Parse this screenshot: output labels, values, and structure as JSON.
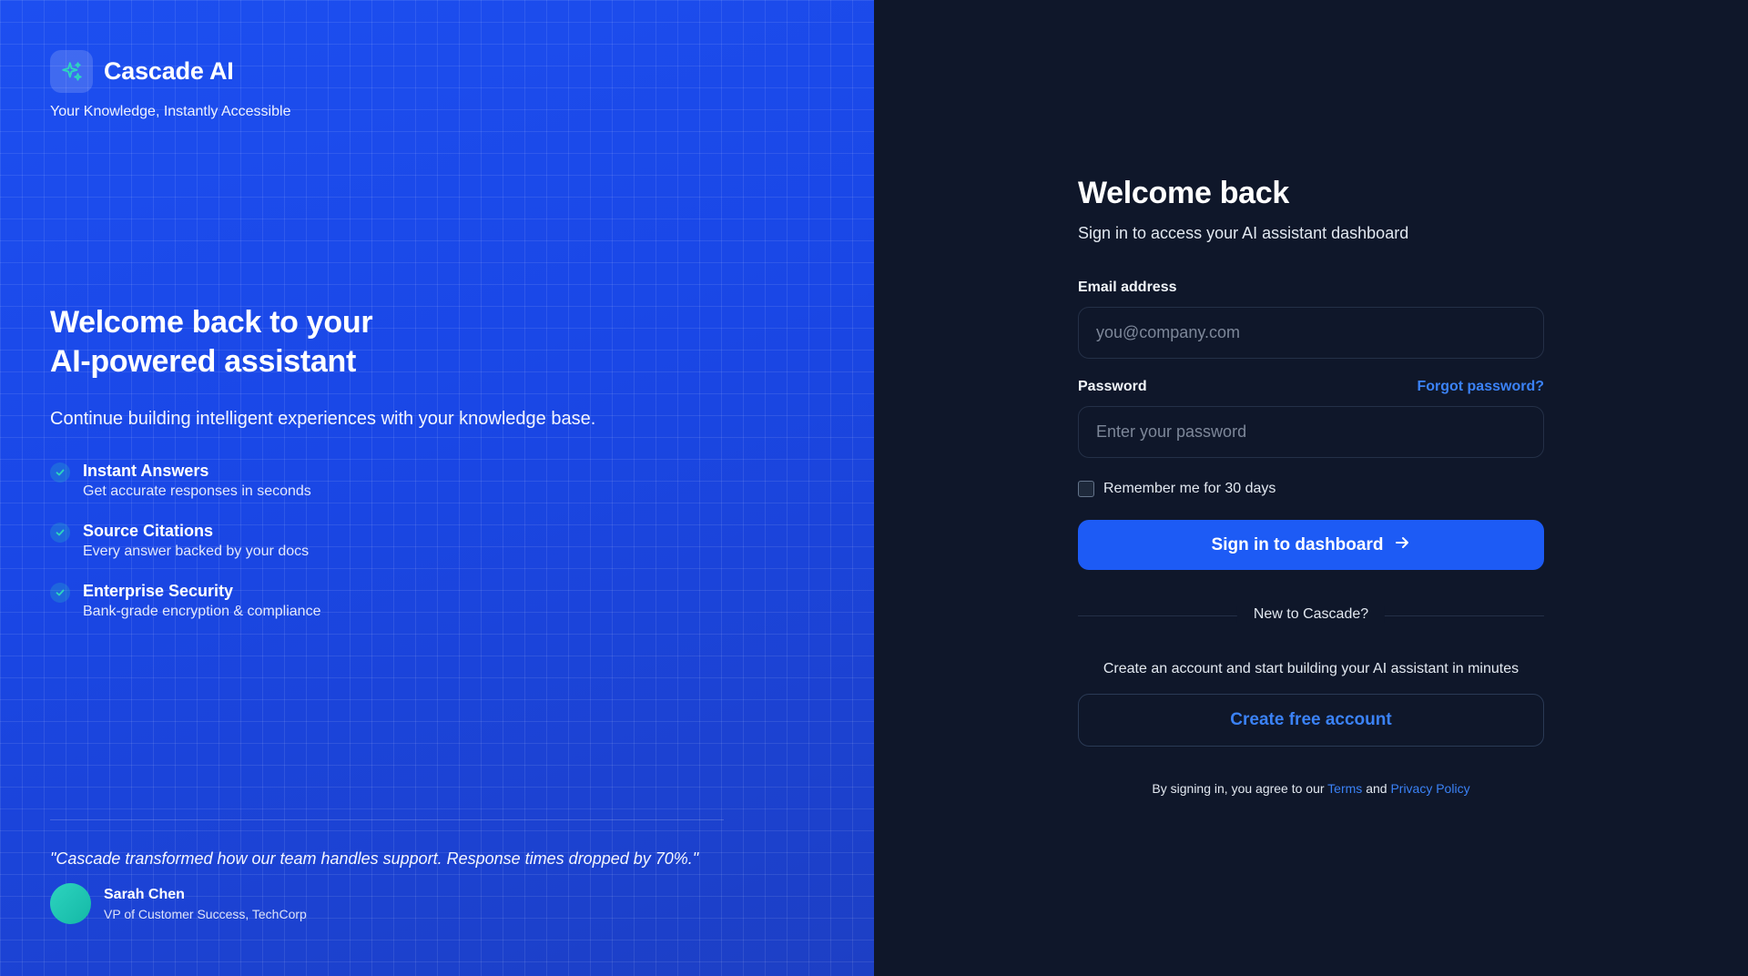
{
  "brand": {
    "name": "Cascade AI",
    "tagline": "Your Knowledge, Instantly Accessible",
    "logo_icon": "sparkles-icon"
  },
  "hero": {
    "title_line1": "Welcome back to your",
    "title_line2": "AI-powered assistant",
    "subtitle": "Continue building intelligent experiences with your knowledge base."
  },
  "features": [
    {
      "title": "Instant Answers",
      "desc": "Get accurate responses in seconds"
    },
    {
      "title": "Source Citations",
      "desc": "Every answer backed by your docs"
    },
    {
      "title": "Enterprise Security",
      "desc": "Bank-grade encryption & compliance"
    }
  ],
  "testimonial": {
    "quote": "\"Cascade transformed how our team handles support. Response times dropped by 70%.\"",
    "name": "Sarah Chen",
    "role": "VP of Customer Success, TechCorp"
  },
  "form": {
    "title": "Welcome back",
    "subtitle": "Sign in to access your AI assistant dashboard",
    "email_label": "Email address",
    "email_placeholder": "you@company.com",
    "email_value": "",
    "password_label": "Password",
    "forgot_label": "Forgot password?",
    "password_placeholder": "Enter your password",
    "password_value": "",
    "remember_label": "Remember me for 30 days",
    "remember_checked": false,
    "submit_label": "Sign in to dashboard",
    "divider_text": "New to Cascade?",
    "signup_prompt": "Create an account and start building your AI assistant in minutes",
    "signup_label": "Create free account",
    "legal_prefix": "By signing in, you agree to our",
    "legal_terms": "Terms",
    "legal_and": "and",
    "legal_privacy": "Privacy Policy"
  },
  "colors": {
    "accent": "#1d5bf5",
    "link": "#3b82f6",
    "left_bg": "#1a47e6",
    "right_bg": "#0f172a",
    "check_teal": "#2dd4bf"
  }
}
